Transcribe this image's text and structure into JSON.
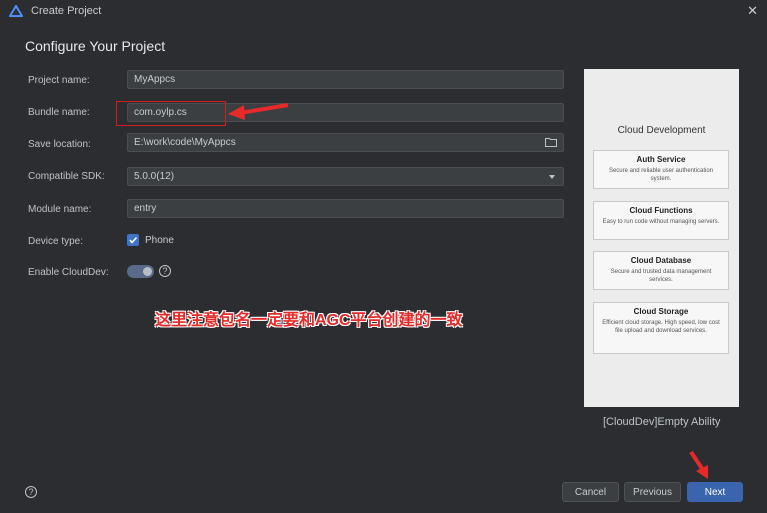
{
  "window": {
    "title": "Create Project",
    "close_icon": "close-icon"
  },
  "heading": "Configure Your Project",
  "form": {
    "project_name_label": "Project name:",
    "project_name_value": "MyAppcs",
    "bundle_name_label": "Bundle name:",
    "bundle_name_value": "com.oylp.cs",
    "save_location_label": "Save location:",
    "save_location_value": "E:\\work\\code\\MyAppcs",
    "compatible_sdk_label": "Compatible SDK:",
    "compatible_sdk_value": "5.0.0(12)",
    "module_name_label": "Module name:",
    "module_name_value": "entry",
    "device_type_label": "Device type:",
    "device_type_option": "Phone",
    "device_type_checked": true,
    "enable_clouddev_label": "Enable CloudDev:",
    "enable_clouddev_on": true
  },
  "annotation_text": "这里注意包名一定要和AGC平台创建的一致",
  "preview": {
    "title": "Cloud Development",
    "cards": [
      {
        "title": "Auth Service",
        "desc": "Secure and reliable user authentication system."
      },
      {
        "title": "Cloud Functions",
        "desc": "Easy to run code without managing servers."
      },
      {
        "title": "Cloud Database",
        "desc": "Secure and trusted data management services."
      },
      {
        "title": "Cloud Storage",
        "desc": "Efficient cloud storage. High speed, low cost file upload and download services."
      }
    ],
    "template_name": "[CloudDev]Empty Ability"
  },
  "buttons": {
    "cancel": "Cancel",
    "previous": "Previous",
    "next": "Next"
  },
  "colors": {
    "accent": "#3a64ae",
    "annotation": "#e62a2a"
  }
}
